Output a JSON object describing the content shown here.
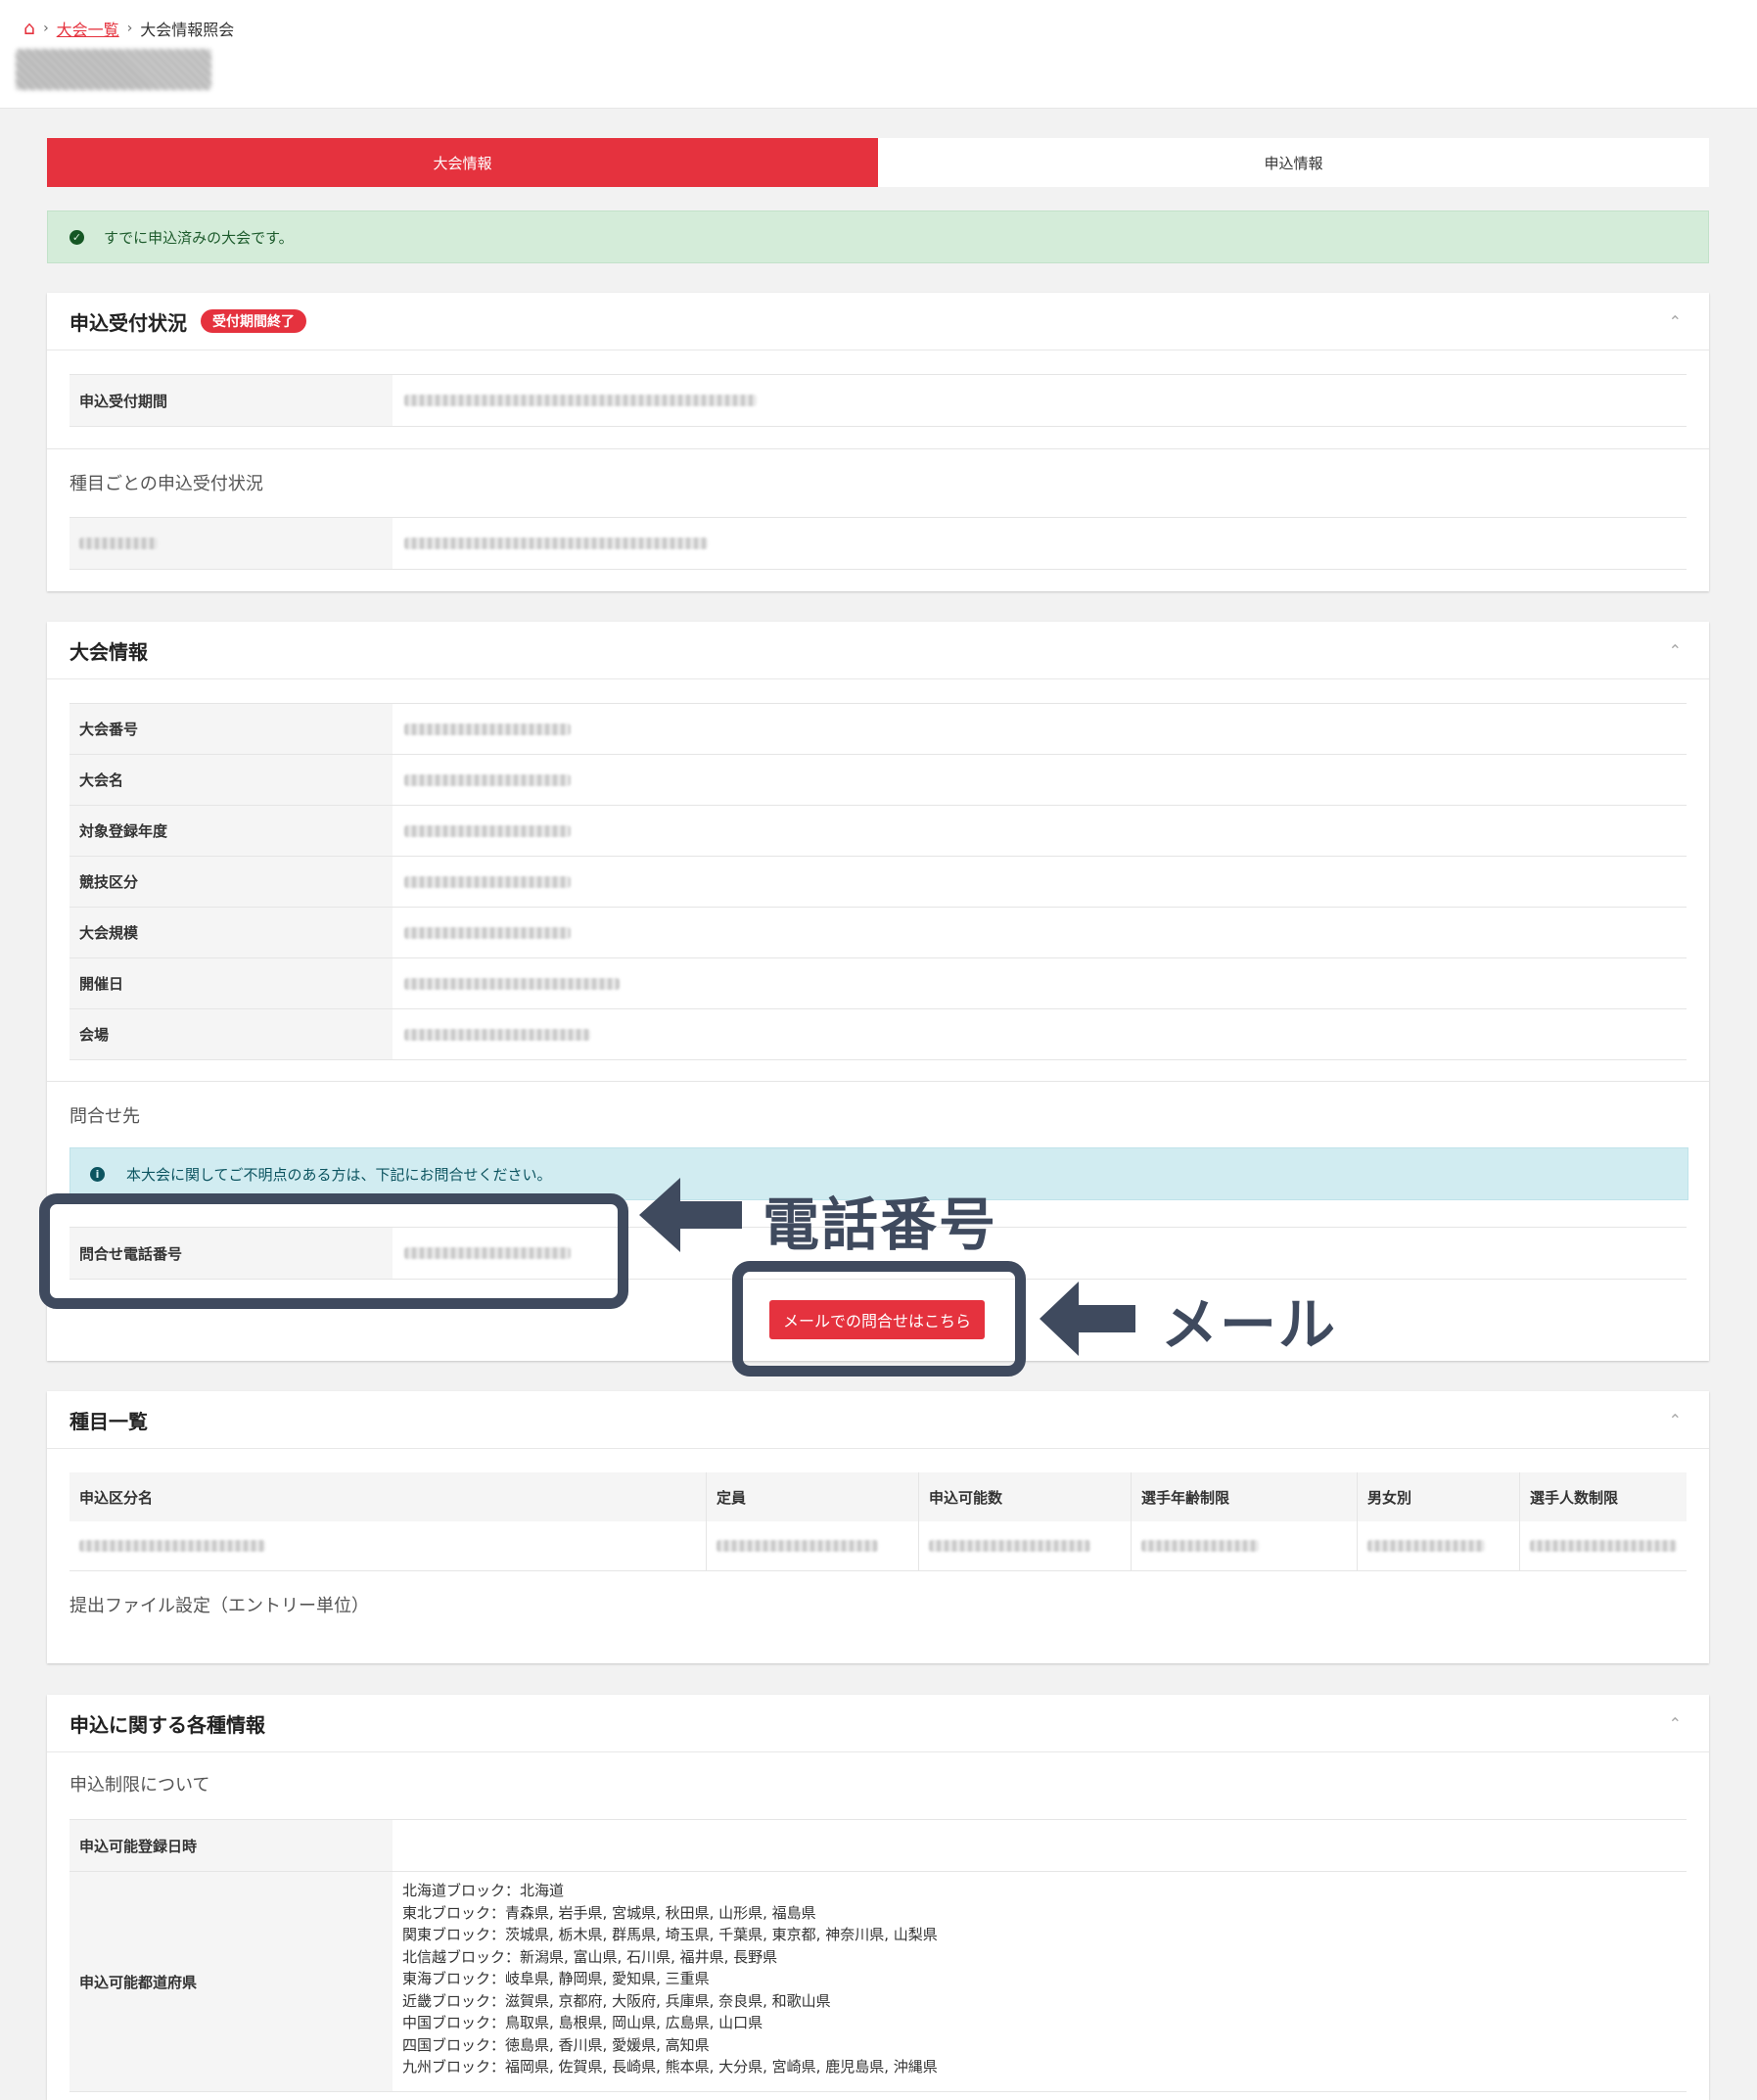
{
  "breadcrumb": {
    "home_icon": "home-icon",
    "link": "大会一覧",
    "current": "大会情報照会"
  },
  "tabs": [
    {
      "label": "大会情報",
      "active": true
    },
    {
      "label": "申込情報",
      "active": false
    }
  ],
  "status_alert": {
    "text": "すでに申込済みの大会です。"
  },
  "reception": {
    "title": "申込受付状況",
    "badge": "受付期間終了",
    "period_label": "申込受付期間",
    "per_event_heading": "種目ごとの申込受付状況"
  },
  "tournament_info": {
    "title": "大会情報",
    "rows": [
      {
        "label": "大会番号"
      },
      {
        "label": "大会名"
      },
      {
        "label": "対象登録年度"
      },
      {
        "label": "競技区分"
      },
      {
        "label": "大会規模"
      },
      {
        "label": "開催日"
      },
      {
        "label": "会場"
      }
    ],
    "contact_heading": "問合せ先",
    "contact_alert": "本大会に関してご不明点のある方は、下記にお問合せください。",
    "phone_label": "問合せ電話番号",
    "mail_button": "メールでの問合せはこちら"
  },
  "annotations": {
    "phone": "電話番号",
    "mail": "メール"
  },
  "events": {
    "title": "種目一覧",
    "columns": [
      "申込区分名",
      "定員",
      "申込可能数",
      "選手年齢制限",
      "男女別",
      "選手人数制限"
    ],
    "file_setting": "提出ファイル設定（エントリー単位）"
  },
  "application_info": {
    "title": "申込に関する各種情報",
    "limit_heading": "申込制限について",
    "reg_date_label": "申込可能登録日時",
    "prefecture_label": "申込可能都道府県",
    "regions": [
      "北海道ブロック：北海道",
      "東北ブロック：青森県, 岩手県, 宮城県, 秋田県, 山形県, 福島県",
      "関東ブロック：茨城県, 栃木県, 群馬県, 埼玉県, 千葉県, 東京都, 神奈川県, 山梨県",
      "北信越ブロック：新潟県, 富山県, 石川県, 福井県, 長野県",
      "東海ブロック：岐阜県, 静岡県, 愛知県, 三重県",
      "近畿ブロック：滋賀県, 京都府, 大阪府, 兵庫県, 奈良県, 和歌山県",
      "中国ブロック：鳥取県, 島根県, 岡山県, 広島県, 山口県",
      "四国ブロック：徳島県, 香川県, 愛媛県, 高知県",
      "九州ブロック：福岡県, 佐賀県, 長崎県, 熊本県, 大分県, 宮崎県, 鹿児島県, 沖縄県"
    ]
  },
  "colors": {
    "accent": "#e5323e",
    "annotation": "#3f4a5e",
    "success_bg": "#d4ecd9",
    "info_bg": "#d1ecf1"
  }
}
